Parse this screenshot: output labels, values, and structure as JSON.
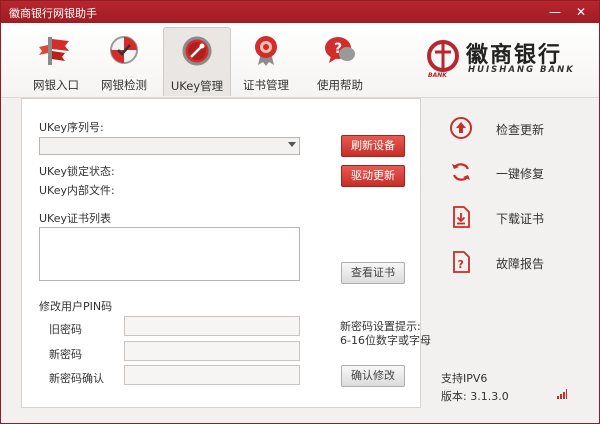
{
  "window": {
    "title": "徽商银行网银助手",
    "minimize": "—",
    "close": "✕"
  },
  "tabs": [
    {
      "label": "网银入口"
    },
    {
      "label": "网银检测"
    },
    {
      "label": "UKey管理"
    },
    {
      "label": "证书管理"
    },
    {
      "label": "使用帮助"
    }
  ],
  "logo": {
    "cn": "徽商银行",
    "en": "HUISHANG BANK",
    "bank": "BANK"
  },
  "main": {
    "serial_label": "UKey序列号:",
    "serial_value": "",
    "refresh_button": "刷新设备",
    "lock_label": "UKey锁定状态:",
    "files_label": "UKey内部文件:",
    "driver_button": "驱动更新",
    "cert_list_label": "UKey证书列表",
    "view_cert_button": "查看证书",
    "pin_section_label": "修改用户PIN码",
    "old_pin_label": "旧密码",
    "new_pin_label": "新密码",
    "confirm_pin_label": "新密码确认",
    "hint_title": "新密码设置提示:",
    "hint_body": "6-16位数字或字母",
    "confirm_button": "确认修改"
  },
  "side": {
    "items": [
      {
        "label": "检查更新"
      },
      {
        "label": "一键修复"
      },
      {
        "label": "下载证书"
      },
      {
        "label": "故障报告"
      }
    ],
    "ipv6": "支持IPV6",
    "version": "版本: 3.1.3.0"
  },
  "colors": {
    "brand_red": "#b8262e",
    "button_red": "#d63a33"
  }
}
